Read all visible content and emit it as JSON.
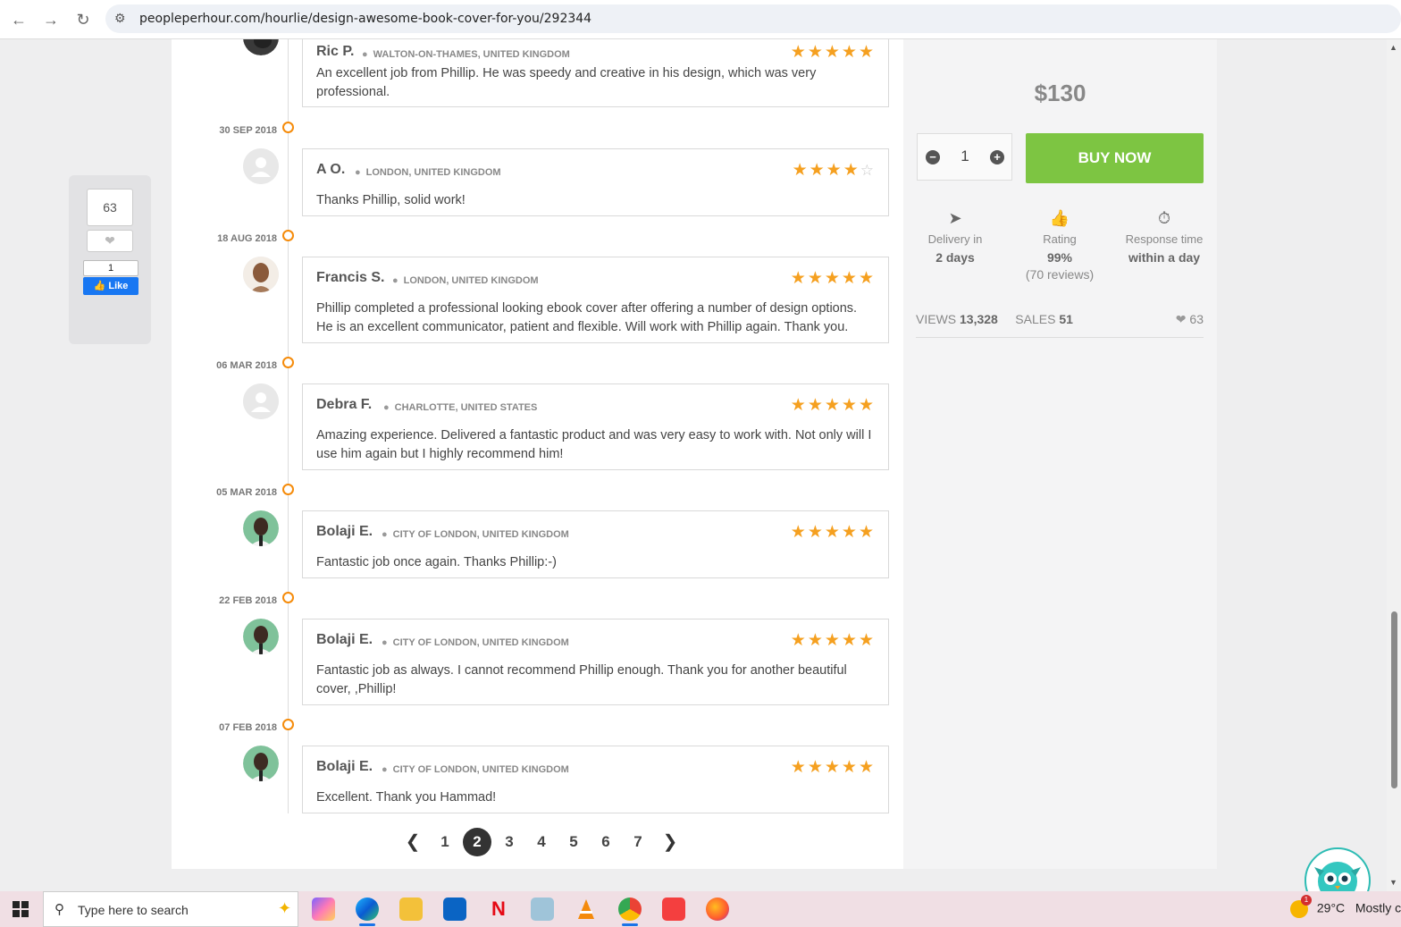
{
  "browser": {
    "url": "peopleperhour.com/hourlie/design-awesome-book-cover-for-you/292344"
  },
  "share": {
    "count": "63",
    "fb_count": "1",
    "fb_like": "Like"
  },
  "reviews": [
    {
      "date": "",
      "name": "Ric P.",
      "location": "WALTON-ON-THAMES, UNITED KINGDOM",
      "stars": 5,
      "text": "An excellent job from Phillip. He was speedy and creative in his design, which was very professional.",
      "avatar": "photo-dark"
    },
    {
      "date": "30 SEP 2018",
      "name": "A O.",
      "location": "LONDON, UNITED KINGDOM",
      "stars": 4,
      "text": "Thanks Phillip, solid work!",
      "avatar": "placeholder"
    },
    {
      "date": "18 AUG 2018",
      "name": "Francis S.",
      "location": "LONDON, UNITED KINGDOM",
      "stars": 5,
      "text": "Phillip completed a professional looking ebook cover after offering a number of design options. He is an excellent communicator, patient and flexible. Will work with Phillip again. Thank you.",
      "avatar": "photo-man"
    },
    {
      "date": "06 MAR 2018",
      "name": "Debra F.",
      "location": "CHARLOTTE, UNITED STATES",
      "stars": 5,
      "text": "Amazing experience. Delivered a fantastic product and was very easy to work with. Not only will I use him again but I highly recommend him!",
      "avatar": "placeholder"
    },
    {
      "date": "05 MAR 2018",
      "name": "Bolaji E.",
      "location": "CITY OF LONDON, UNITED KINGDOM",
      "stars": 5,
      "text": "Fantastic job once again. Thanks Phillip:-)",
      "avatar": "photo-woman"
    },
    {
      "date": "22 FEB 2018",
      "name": "Bolaji E.",
      "location": "CITY OF LONDON, UNITED KINGDOM",
      "stars": 5,
      "text": "Fantastic job as always. I cannot recommend Phillip enough. Thank you for another beautiful cover, ,Phillip!",
      "avatar": "photo-woman"
    },
    {
      "date": "07 FEB 2018",
      "name": "Bolaji E.",
      "location": "CITY OF LONDON, UNITED KINGDOM",
      "stars": 5,
      "text": "Excellent. Thank you Hammad!",
      "avatar": "photo-woman"
    }
  ],
  "pagination": {
    "pages": [
      "1",
      "2",
      "3",
      "4",
      "5",
      "6",
      "7"
    ],
    "current": "2"
  },
  "sidebar": {
    "price": "$130",
    "quantity": "1",
    "buy_label": "BUY NOW",
    "stats": [
      {
        "icon": "paper-plane-icon",
        "label": "Delivery in",
        "value": "2 days",
        "sub": ""
      },
      {
        "icon": "thumbs-up-icon",
        "label": "Rating",
        "value": "99%",
        "sub": "(70 reviews)"
      },
      {
        "icon": "stopwatch-icon",
        "label": "Response time",
        "value": "within a day",
        "sub": ""
      }
    ],
    "views_label": "VIEWS",
    "views": "13,328",
    "sales_label": "SALES",
    "sales": "51",
    "likes": "63"
  },
  "taskbar": {
    "search_placeholder": "Type here to search",
    "weather_temp": "29°C",
    "weather_desc": "Mostly cl",
    "weather_badge": "1"
  },
  "colors": {
    "accent_orange": "#f58b0a",
    "star": "#f5a020",
    "buy_green": "#7dc542"
  }
}
